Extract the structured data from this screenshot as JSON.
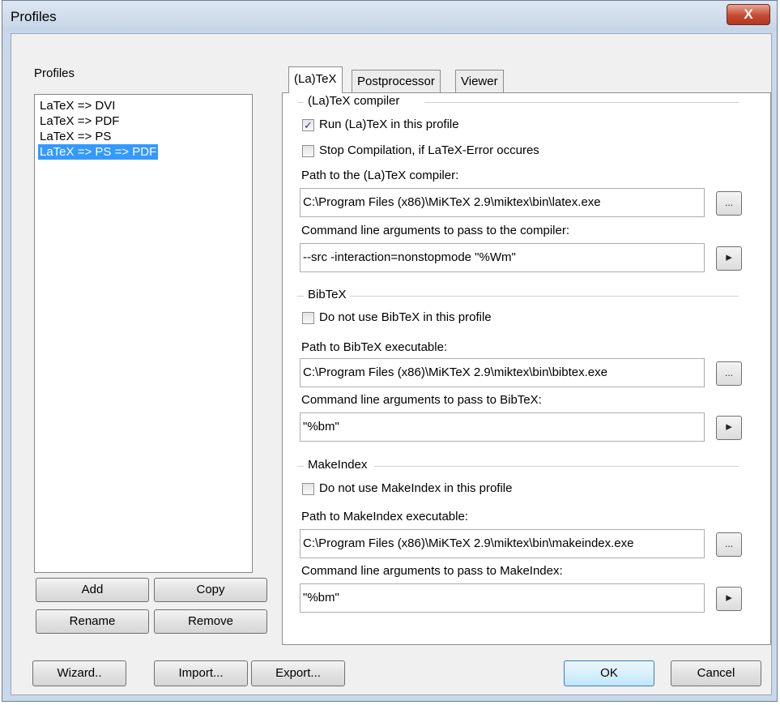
{
  "window": {
    "title": "Profiles",
    "close_glyph": "X"
  },
  "profiles_panel": {
    "label": "Profiles",
    "items": [
      "LaTeX => DVI",
      "LaTeX => PDF",
      "LaTeX => PS",
      "LaTeX => PS => PDF"
    ],
    "selected_index": 3,
    "buttons": {
      "add": "Add",
      "copy": "Copy",
      "rename": "Rename",
      "remove": "Remove"
    }
  },
  "tabs": [
    "(La)TeX",
    "Postprocessor",
    "Viewer"
  ],
  "active_tab": 0,
  "latex_section": {
    "header": "(La)TeX compiler",
    "run_label": "Run (La)TeX in this profile",
    "run_checked": true,
    "stop_label": "Stop Compilation, if LaTeX-Error occures",
    "stop_checked": false,
    "path_label": "Path to the (La)TeX compiler:",
    "path_value": "C:\\Program Files (x86)\\MiKTeX 2.9\\miktex\\bin\\latex.exe",
    "args_label": "Command line arguments to pass to the compiler:",
    "args_value": "--src -interaction=nonstopmode \"%Wm\""
  },
  "bibtex_section": {
    "header": "BibTeX",
    "disable_label": "Do not use BibTeX in this profile",
    "disable_checked": false,
    "path_label": "Path to BibTeX executable:",
    "path_value": "C:\\Program Files (x86)\\MiKTeX 2.9\\miktex\\bin\\bibtex.exe",
    "args_label": "Command line arguments to pass to BibTeX:",
    "args_value": "\"%bm\""
  },
  "makeindex_section": {
    "header": "MakeIndex",
    "disable_label": "Do not use MakeIndex in this profile",
    "disable_checked": false,
    "path_label": "Path to MakeIndex executable:",
    "path_value": "C:\\Program Files (x86)\\MiKTeX 2.9\\miktex\\bin\\makeindex.exe",
    "args_label": "Command line arguments to pass to MakeIndex:",
    "args_value": "\"%bm\""
  },
  "browse_glyph": "...",
  "arrow_glyph": "▸",
  "check_glyph": "✓",
  "footer_buttons": {
    "wizard": "Wizard..",
    "import": "Import...",
    "export": "Export...",
    "ok": "OK",
    "cancel": "Cancel"
  }
}
